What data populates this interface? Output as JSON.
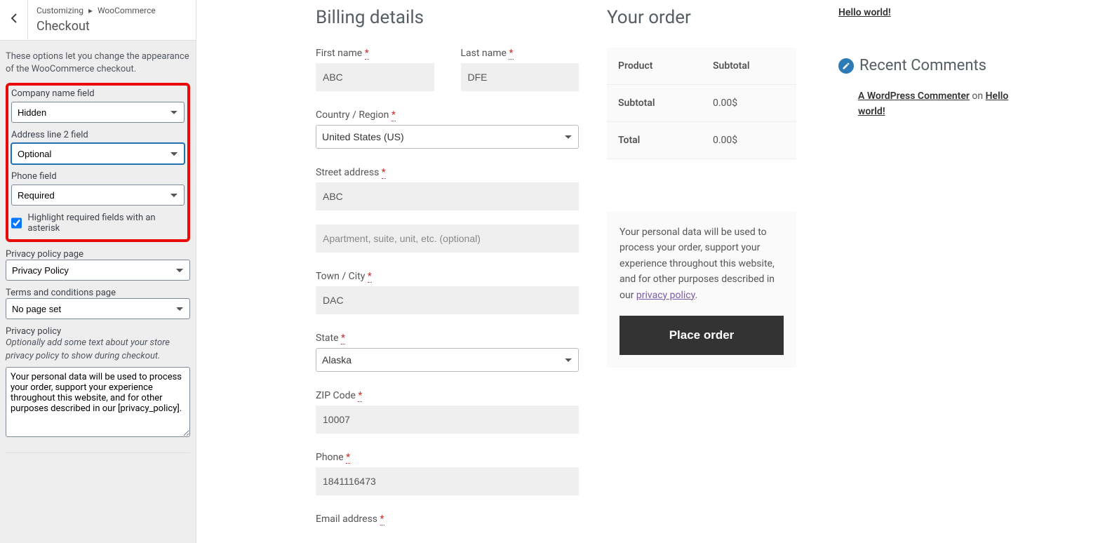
{
  "sidebar": {
    "crumb_customizing": "Customizing",
    "crumb_woocommerce": "WooCommerce",
    "title": "Checkout",
    "intro": "These options let you change the appearance of the WooCommerce checkout.",
    "company_label": "Company name field",
    "company_value": "Hidden",
    "addr2_label": "Address line 2 field",
    "addr2_value": "Optional",
    "phone_label": "Phone field",
    "phone_value": "Required",
    "highlight_cb_label": "Highlight required fields with an asterisk",
    "privacy_page_label": "Privacy policy page",
    "privacy_page_value": "Privacy Policy",
    "tc_label": "Terms and conditions page",
    "tc_value": "No page set",
    "privacy_section_label": "Privacy policy",
    "privacy_help": "Optionally add some text about your store privacy policy to show during checkout.",
    "privacy_text": "Your personal data will be used to process your order, support your experience throughout this website, and for other purposes described in our [privacy_policy]."
  },
  "billing": {
    "heading": "Billing details",
    "first_name_label": "First name",
    "first_name_value": "ABC",
    "last_name_label": "Last name",
    "last_name_value": "DFE",
    "country_label": "Country / Region",
    "country_value": "United States (US)",
    "street_label": "Street address",
    "street_value": "ABC",
    "addr2_placeholder": "Apartment, suite, unit, etc. (optional)",
    "city_label": "Town / City",
    "city_value": "DAC",
    "state_label": "State",
    "state_value": "Alaska",
    "zip_label": "ZIP Code",
    "zip_value": "10007",
    "phone_label": "Phone",
    "phone_value": "1841116473",
    "email_label": "Email address"
  },
  "order": {
    "heading": "Your order",
    "product_th": "Product",
    "subtotal_th": "Subtotal",
    "subtotal_row": "Subtotal",
    "subtotal_val": "0.00$",
    "total_row": "Total",
    "total_val": "0.00$",
    "privacy_text_pre": "Your personal data will be used to process your order, support your experience throughout this website, and for other purposes described in our ",
    "privacy_link_text": "privacy policy",
    "place_order_btn": "Place order"
  },
  "sidecol": {
    "hello_link": "Hello world!",
    "rc_heading": "Recent Comments",
    "commenter": "A WordPress Commenter",
    "on": " on ",
    "post": "Hello world!"
  }
}
